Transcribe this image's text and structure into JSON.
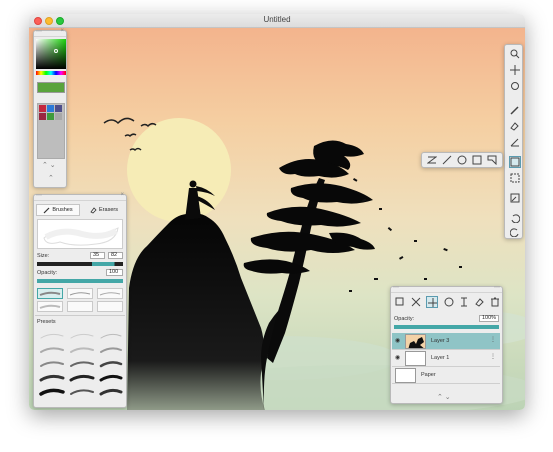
{
  "window": {
    "title": "Untitled"
  },
  "colors": {
    "accent": "#44a7a7",
    "swatch_green": "#59a33c",
    "sun": "#f6ecb6"
  },
  "brushes_panel": {
    "tabs": [
      {
        "label": "Brushes",
        "icon": "brush-icon"
      },
      {
        "label": "Erasers",
        "icon": "eraser-icon"
      }
    ],
    "size_label": "Size:",
    "size_values": [
      "35",
      "82"
    ],
    "opacity_label": "Opacity:",
    "opacity_value": "100",
    "presets_label": "Presets"
  },
  "layers_panel": {
    "opacity_label": "Opacity:",
    "opacity_value": "100%",
    "opacity_level": 1.0,
    "layers": [
      {
        "name": "Layer 3",
        "selected": true
      },
      {
        "name": "Layer 1",
        "selected": false
      },
      {
        "name": "Paper",
        "selected": false
      }
    ]
  },
  "toolbar": {
    "tools": [
      "zoom-icon",
      "move-icon",
      "rotate-icon",
      "brush-icon",
      "eraser-icon",
      "smudge-icon",
      "selection-icon",
      "rect-select-icon",
      "transform-icon",
      "undo-icon",
      "redo-icon"
    ],
    "shape_tools": [
      "line-zigzag-icon",
      "line-icon",
      "circle-icon",
      "rectangle-icon",
      "polygon-icon"
    ]
  }
}
